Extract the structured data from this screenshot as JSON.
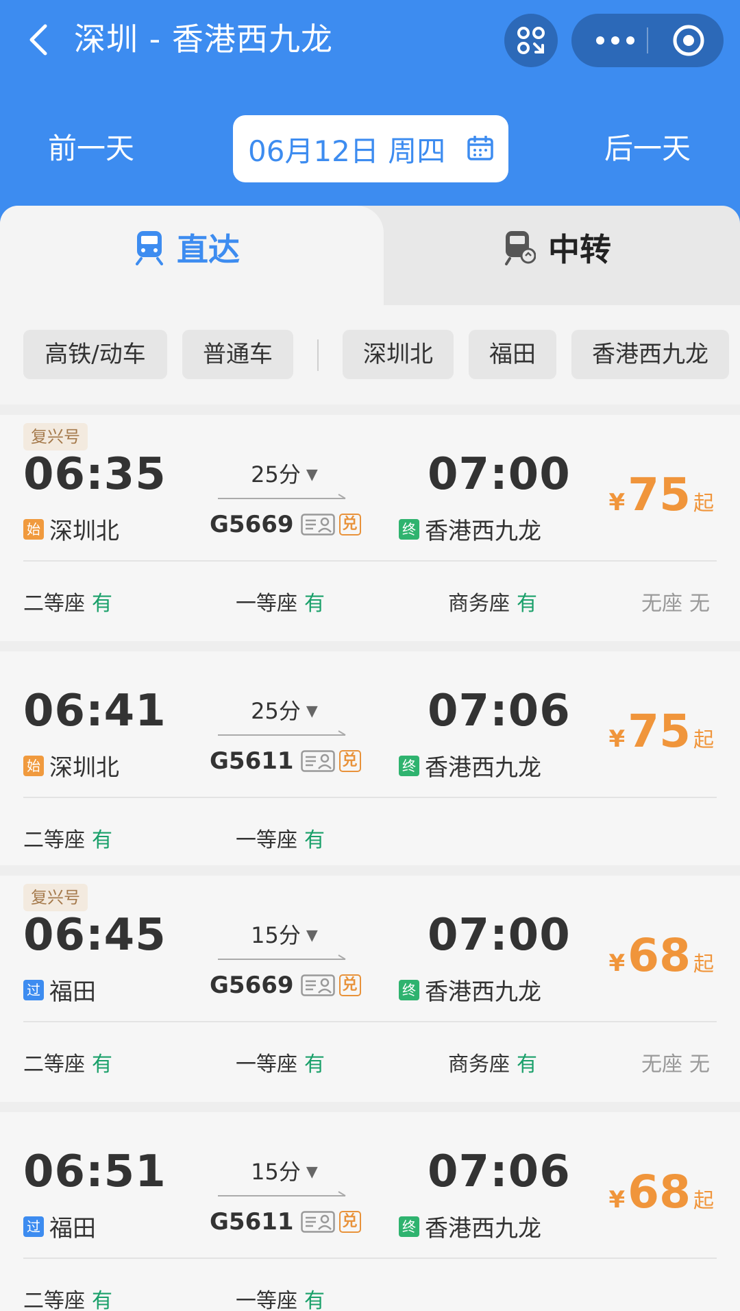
{
  "header": {
    "title": "深圳 - 香港西九龙",
    "prev_day": "前一天",
    "next_day": "后一天",
    "date": "06月12日 周四"
  },
  "tabs": [
    {
      "label": "直达",
      "icon": "train-icon",
      "active": true
    },
    {
      "label": "中转",
      "icon": "transfer-train-icon",
      "active": false
    }
  ],
  "filters": [
    "高铁/动车",
    "普通车",
    "深圳北",
    "福田",
    "香港西九龙"
  ],
  "colors": {
    "brand": "#3d8cf0",
    "price": "#f0953b",
    "available": "#1aa06a"
  },
  "trains": [
    {
      "badge": "复兴号",
      "dep_time": "06:35",
      "dep_tag": "始",
      "dep_station": "深圳北",
      "duration": "25分",
      "train_no": "G5669",
      "dui": "兑",
      "arr_time": "07:00",
      "arr_tag": "终",
      "arr_station": "香港西九龙",
      "yen": "¥",
      "price": "75",
      "price_suffix": "起",
      "seats": [
        {
          "name": "二等座",
          "status": "有"
        },
        {
          "name": "一等座",
          "status": "有"
        },
        {
          "name": "商务座",
          "status": "有"
        },
        {
          "name": "无座",
          "status": "无"
        }
      ]
    },
    {
      "badge": "",
      "dep_time": "06:41",
      "dep_tag": "始",
      "dep_station": "深圳北",
      "duration": "25分",
      "train_no": "G5611",
      "dui": "兑",
      "arr_time": "07:06",
      "arr_tag": "终",
      "arr_station": "香港西九龙",
      "yen": "¥",
      "price": "75",
      "price_suffix": "起",
      "seats": [
        {
          "name": "二等座",
          "status": "有"
        },
        {
          "name": "一等座",
          "status": "有"
        }
      ]
    },
    {
      "badge": "复兴号",
      "dep_time": "06:45",
      "dep_tag": "过",
      "dep_station": "福田",
      "duration": "15分",
      "train_no": "G5669",
      "dui": "兑",
      "arr_time": "07:00",
      "arr_tag": "终",
      "arr_station": "香港西九龙",
      "yen": "¥",
      "price": "68",
      "price_suffix": "起",
      "seats": [
        {
          "name": "二等座",
          "status": "有"
        },
        {
          "name": "一等座",
          "status": "有"
        },
        {
          "name": "商务座",
          "status": "有"
        },
        {
          "name": "无座",
          "status": "无"
        }
      ]
    },
    {
      "badge": "",
      "dep_time": "06:51",
      "dep_tag": "过",
      "dep_station": "福田",
      "duration": "15分",
      "train_no": "G5611",
      "dui": "兑",
      "arr_time": "07:06",
      "arr_tag": "终",
      "arr_station": "香港西九龙",
      "yen": "¥",
      "price": "68",
      "price_suffix": "起",
      "seats": [
        {
          "name": "二等座",
          "status": "有"
        },
        {
          "name": "一等座",
          "status": "有"
        }
      ]
    }
  ]
}
